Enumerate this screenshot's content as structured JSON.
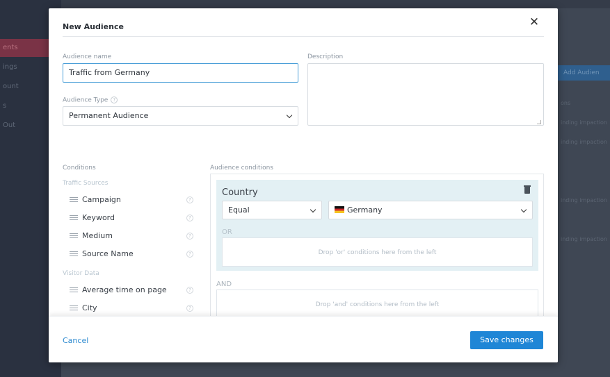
{
  "background": {
    "sidebar_items": [
      "ents",
      "ings",
      "ount",
      "s",
      "Out"
    ],
    "add_button": "Add Audien",
    "list_header": "ons",
    "list_rows": [
      "inding impaction",
      "inding impaction",
      "",
      "",
      "inding impaction",
      "",
      "inding impaction"
    ]
  },
  "modal": {
    "title": "New Audience",
    "audience_name_label": "Audience name",
    "audience_name_value": "Traffic from Germany",
    "description_label": "Description",
    "description_value": "",
    "audience_type_label": "Audience Type",
    "audience_type_value": "Permanent Audience",
    "conditions_label": "Conditions",
    "audience_conditions_label": "Audience conditions",
    "traffic_sources_label": "Traffic Sources",
    "traffic_sources": [
      "Campaign",
      "Keyword",
      "Medium",
      "Source Name"
    ],
    "visitor_data_label": "Visitor Data",
    "visitor_data": [
      "Average time on page",
      "City"
    ],
    "condition_block": {
      "title": "Country",
      "operator": "Equal",
      "value": "Germany",
      "or_label": "OR",
      "or_drop_text": "Drop 'or' conditions here from the left",
      "and_label": "AND",
      "and_drop_text": "Drop 'and' conditions here from the left"
    },
    "cancel_label": "Cancel",
    "save_label": "Save changes"
  }
}
